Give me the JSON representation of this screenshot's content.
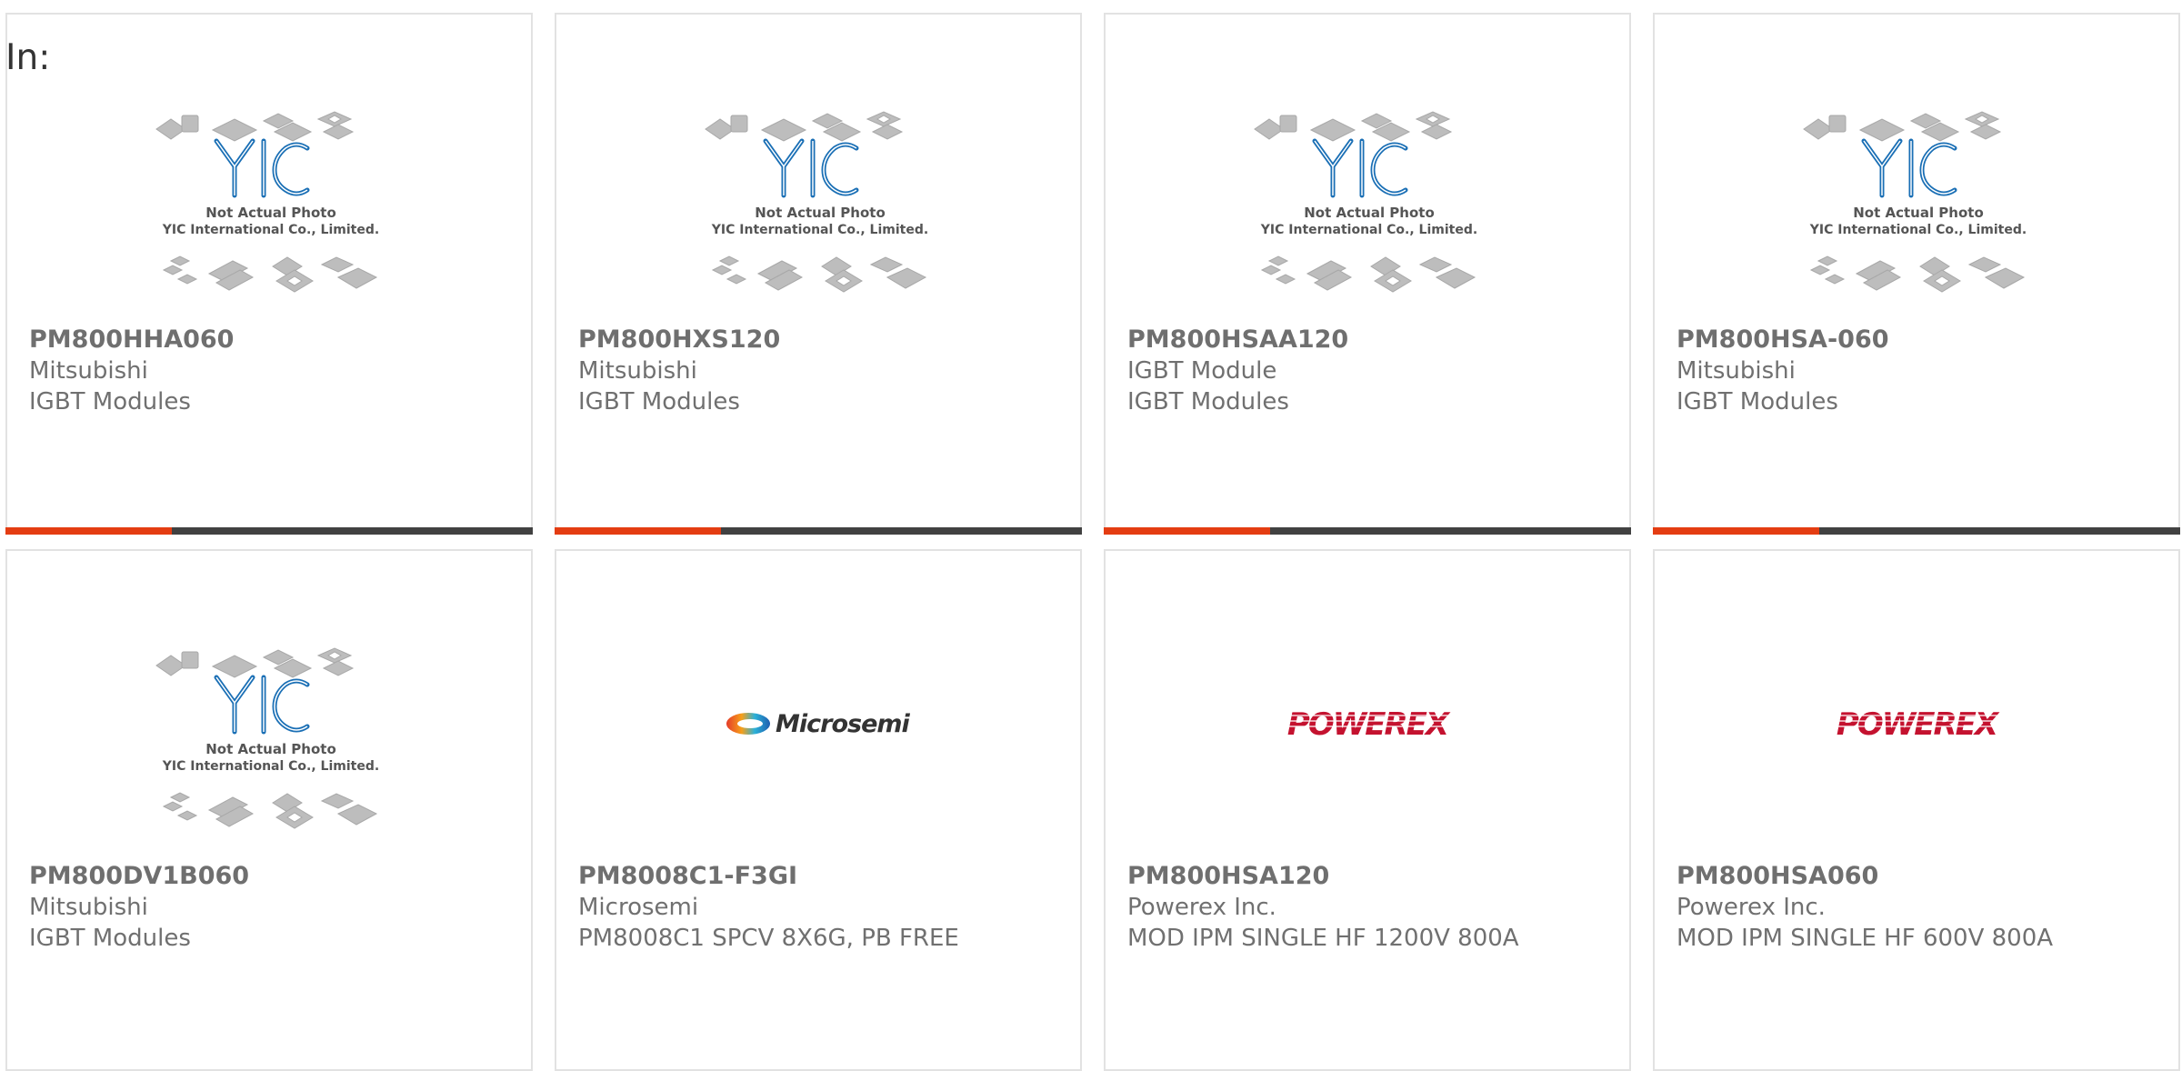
{
  "header": {
    "label": "In:"
  },
  "placeholder_image": {
    "line1": "Not Actual Photo",
    "line2": "YIC International Co., Limited.",
    "logo_text": "YIC"
  },
  "brand_logos": {
    "microsemi": "Microsemi",
    "powerex": "POWEREX"
  },
  "colors": {
    "accent": "#e43d12",
    "bar_dark": "#414141",
    "yic_blue": "#1a6fb5",
    "powerex_red": "#c4122f"
  },
  "products": [
    {
      "part_number": "PM800HHA060",
      "manufacturer": "Mitsubishi",
      "description": "IGBT Modules",
      "image": "yic-placeholder"
    },
    {
      "part_number": "PM800HXS120",
      "manufacturer": "Mitsubishi",
      "description": "IGBT Modules",
      "image": "yic-placeholder"
    },
    {
      "part_number": "PM800HSAA120",
      "manufacturer": "IGBT Module",
      "description": "IGBT Modules",
      "image": "yic-placeholder"
    },
    {
      "part_number": "PM800HSA-060",
      "manufacturer": "Mitsubishi",
      "description": "IGBT Modules",
      "image": "yic-placeholder"
    },
    {
      "part_number": "PM800DV1B060",
      "manufacturer": "Mitsubishi",
      "description": "IGBT Modules",
      "image": "yic-placeholder"
    },
    {
      "part_number": "PM8008C1-F3GI",
      "manufacturer": "Microsemi",
      "description": "PM8008C1 SPCV 8X6G, PB FREE",
      "image": "microsemi-logo"
    },
    {
      "part_number": "PM800HSA120",
      "manufacturer": "Powerex Inc.",
      "description": "MOD IPM SINGLE HF 1200V 800A",
      "image": "powerex-logo"
    },
    {
      "part_number": "PM800HSA060",
      "manufacturer": "Powerex Inc.",
      "description": "MOD IPM SINGLE HF 600V 800A",
      "image": "powerex-logo"
    }
  ]
}
